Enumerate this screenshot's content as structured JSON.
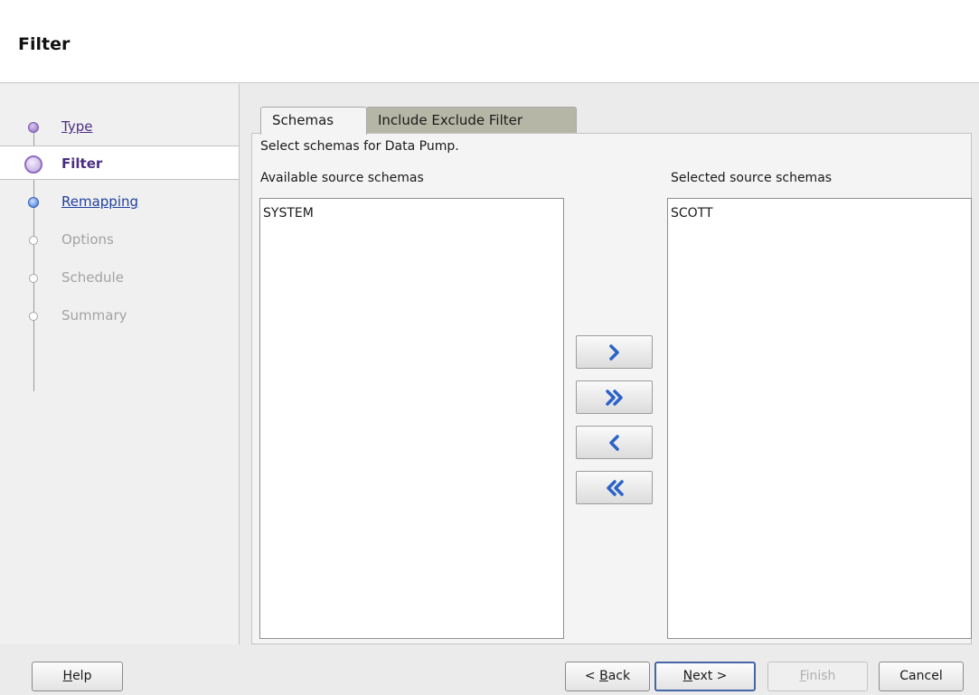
{
  "header": {
    "title": "Filter"
  },
  "steps": [
    {
      "label": "Type",
      "state": "done"
    },
    {
      "label": "Filter",
      "state": "current"
    },
    {
      "label": "Remapping",
      "state": "next"
    },
    {
      "label": "Options",
      "state": "todo"
    },
    {
      "label": "Schedule",
      "state": "todo"
    },
    {
      "label": "Summary",
      "state": "todo"
    }
  ],
  "tabs": [
    {
      "label": "Schemas",
      "active": true
    },
    {
      "label": "Include Exclude Filter",
      "active": false
    }
  ],
  "main": {
    "instruction": "Select schemas for Data Pump.",
    "available_label": "Available source schemas",
    "selected_label": "Selected source schemas",
    "available_items": [
      "SYSTEM"
    ],
    "selected_items": [
      "SCOTT"
    ],
    "move_buttons": [
      {
        "icon": "move-right-icon"
      },
      {
        "icon": "move-all-right-icon"
      },
      {
        "icon": "move-left-icon"
      },
      {
        "icon": "move-all-left-icon"
      }
    ]
  },
  "footer": {
    "help": {
      "mnemonic": "H",
      "rest": "elp"
    },
    "back": {
      "prefix": "< ",
      "mnemonic": "B",
      "rest": "ack"
    },
    "next": {
      "mnemonic": "N",
      "rest": "ext >"
    },
    "finish": {
      "mnemonic": "F",
      "rest": "inish",
      "disabled": true
    },
    "cancel": {
      "label": "Cancel"
    }
  },
  "colors": {
    "accent_purple": "#4b2e83",
    "link_blue": "#1f3fa0",
    "arrow_blue": "#2a62c9",
    "inactive_tab": "#b6b6a6"
  }
}
